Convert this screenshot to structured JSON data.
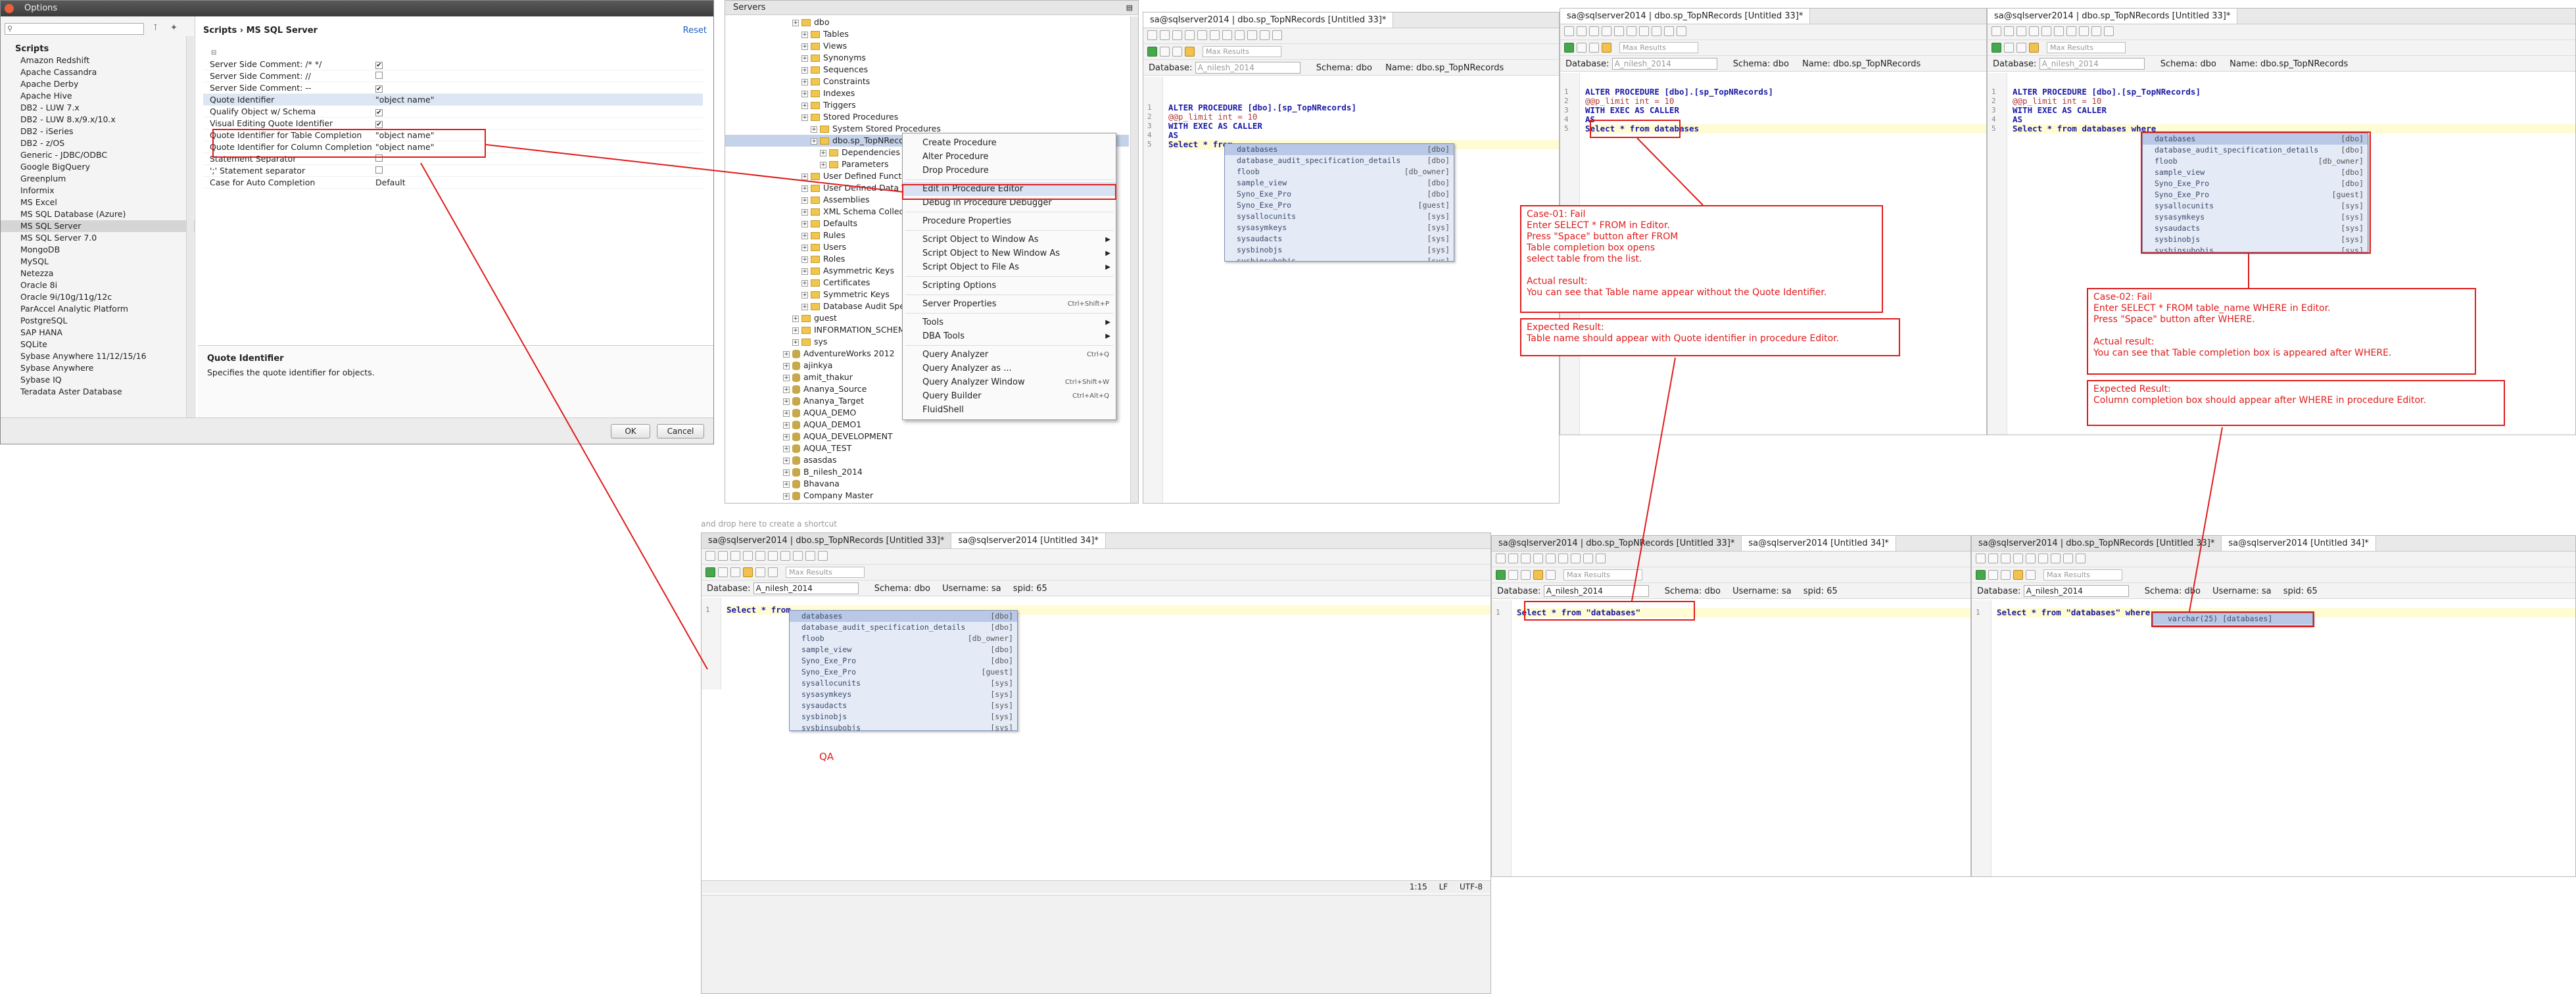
{
  "options": {
    "title": "Options",
    "heading": "Scripts",
    "panel_title": "Scripts › MS SQL Server",
    "reset": "Reset",
    "drivers": [
      "Amazon Redshift",
      "Apache Cassandra",
      "Apache Derby",
      "Apache Hive",
      "DB2 - LUW 7.x",
      "DB2 - LUW 8.x/9.x/10.x",
      "DB2 - iSeries",
      "DB2 - z/OS",
      "Generic - JDBC/ODBC",
      "Google BigQuery",
      "Greenplum",
      "Informix",
      "MS Excel",
      "MS SQL Database (Azure)",
      "MS SQL Server",
      "MS SQL Server 7.0",
      "MongoDB",
      "MySQL",
      "Netezza",
      "Oracle 8i",
      "Oracle 9i/10g/11g/12c",
      "ParAccel Analytic Platform",
      "PostgreSQL",
      "SAP HANA",
      "SQLite",
      "Sybase Anywhere 11/12/15/16",
      "Sybase Anywhere",
      "Sybase IQ",
      "Teradata Aster Database"
    ],
    "settings": [
      {
        "name": "Server Side Comment: /* */",
        "value": "✔"
      },
      {
        "name": "Server Side Comment: //",
        "value": ""
      },
      {
        "name": "Server Side Comment: --",
        "value": "✔"
      },
      {
        "name": "Quote Identifier",
        "value": "\"object name\""
      },
      {
        "name": "Qualify Object w/ Schema",
        "value": "✔"
      },
      {
        "name": "Visual Editing Quote Identifier",
        "value": "✔"
      },
      {
        "name": "Quote Identifier for Table Completion",
        "value": "\"object name\""
      },
      {
        "name": "Quote Identifier for Column Completion",
        "value": "\"object name\""
      },
      {
        "name": "Statement Separator",
        "value": ""
      },
      {
        "name": "';' Statement separator",
        "value": ""
      },
      {
        "name": "Case for Auto Completion",
        "value": "Default"
      }
    ],
    "desc_title": "Quote Identifier",
    "desc_text": "Specifies the quote identifier for objects.",
    "ok": "OK",
    "cancel": "Cancel"
  },
  "servers": {
    "title": "Servers",
    "nodes": [
      "dbo",
      "Tables",
      "Views",
      "Synonyms",
      "Sequences",
      "Constraints",
      "Indexes",
      "Triggers",
      "Stored Procedures",
      "System Stored Procedures",
      "dbo.sp_TopNRecords",
      "Dependencies",
      "Parameters",
      "User Defined Functions",
      "User Defined Data Types",
      "Assemblies",
      "XML Schema Collections",
      "Defaults",
      "Rules",
      "Users",
      "Roles",
      "Asymmetric Keys",
      "Certificates",
      "Symmetric Keys",
      "Database Audit Specifications",
      "guest",
      "INFORMATION_SCHEMA",
      "sys",
      "AdventureWorks 2012",
      "ajinkya",
      "amit_thakur",
      "Ananya_Source",
      "Ananya_Target",
      "AQUA_DEMO",
      "AQUA_DEMO1",
      "AQUA_DEVELOPMENT",
      "AQUA_TEST",
      "asasdas",
      "B_nilesh_2014",
      "Bhavana",
      "Company Master"
    ],
    "drop_hint": "and drop here to create a shortcut"
  },
  "context_menu": {
    "items": [
      {
        "label": "Create Procedure",
        "shortcut": "",
        "arrow": ""
      },
      {
        "label": "Alter Procedure",
        "shortcut": "",
        "arrow": ""
      },
      {
        "label": "Drop Procedure",
        "shortcut": "",
        "arrow": ""
      },
      {
        "label": "---"
      },
      {
        "label": "Edit in Procedure Editor",
        "shortcut": "",
        "arrow": ""
      },
      {
        "label": "Debug in Procedure Debugger",
        "shortcut": "",
        "arrow": ""
      },
      {
        "label": "---"
      },
      {
        "label": "Procedure Properties",
        "shortcut": "",
        "arrow": ""
      },
      {
        "label": "---"
      },
      {
        "label": "Script Object to Window As",
        "shortcut": "",
        "arrow": "▶"
      },
      {
        "label": "Script Object to New Window As",
        "shortcut": "",
        "arrow": "▶"
      },
      {
        "label": "Script Object to File As",
        "shortcut": "",
        "arrow": "▶"
      },
      {
        "label": "---"
      },
      {
        "label": "Scripting Options",
        "shortcut": "",
        "arrow": ""
      },
      {
        "label": "---"
      },
      {
        "label": "Server Properties",
        "shortcut": "Ctrl+Shift+P",
        "arrow": ""
      },
      {
        "label": "---"
      },
      {
        "label": "Tools",
        "shortcut": "",
        "arrow": "▶"
      },
      {
        "label": "DBA Tools",
        "shortcut": "",
        "arrow": "▶"
      },
      {
        "label": "---"
      },
      {
        "label": "Query Analyzer",
        "shortcut": "Ctrl+Q",
        "arrow": ""
      },
      {
        "label": "Query Analyzer as ...",
        "shortcut": "",
        "arrow": ""
      },
      {
        "label": "Query Analyzer Window",
        "shortcut": "Ctrl+Shift+W",
        "arrow": ""
      },
      {
        "label": "Query Builder",
        "shortcut": "Ctrl+Alt+Q",
        "arrow": ""
      },
      {
        "label": "FluidShell",
        "shortcut": "",
        "arrow": ""
      }
    ]
  },
  "editor_common": {
    "max_results": "Max Results",
    "database_label": "Database:",
    "schema_label": "Schema:",
    "schema": "dbo",
    "name_label": "Name:",
    "proc_name": "dbo.sp_TopNRecords",
    "db_greyed": "A_nilesh_2014",
    "db": "A_nilesh_2014",
    "username_label": "Username:",
    "username": "sa",
    "spid_label": "spid:",
    "spid": "65",
    "tab33": "sa@sqlserver2014 | dbo.sp_TopNRecords [Untitled 33]*",
    "tab34": "sa@sqlserver2014 [Untitled 34]*",
    "status_pos": "1:15",
    "status_lf": "LF",
    "status_enc": "UTF-8"
  },
  "proc_lines": {
    "l1": "ALTER PROCEDURE [dbo].[sp_TopNRecords]",
    "l2": "@@p_limit int = 10",
    "l3": "WITH EXEC AS CALLER",
    "l4": "AS",
    "l5a": "Select * from",
    "l5b": "Select * from databases",
    "l5c": "Select * from databases where"
  },
  "qa_lines": {
    "a": "Select * from",
    "b": "Select * from \"databases\"",
    "c": "Select * from \"databases\" where"
  },
  "autocomplete": [
    {
      "name": "databases",
      "schema": "[dbo]"
    },
    {
      "name": "database_audit_specification_details",
      "schema": "[dbo]"
    },
    {
      "name": "floob",
      "schema": "[db_owner]"
    },
    {
      "name": "sample_view",
      "schema": "[dbo]"
    },
    {
      "name": "Syno_Exe_Pro",
      "schema": "[dbo]"
    },
    {
      "name": "Syno_Exe_Pro",
      "schema": "[guest]"
    },
    {
      "name": "sysallocunits",
      "schema": "[sys]"
    },
    {
      "name": "sysasymkeys",
      "schema": "[sys]"
    },
    {
      "name": "sysaudacts",
      "schema": "[sys]"
    },
    {
      "name": "sysbinobjs",
      "schema": "[sys]"
    },
    {
      "name": "sysbinsubobjs",
      "schema": "[sys]"
    }
  ],
  "column_completion": "varchar(25)   [databases]",
  "notes": {
    "case1_title": "Case-01: Fail",
    "case1_steps": "Enter SELECT * FROM in Editor.\nPress \"Space\" button after FROM\nTable completion box opens\nselect table from the list.",
    "case1_actual_title": "Actual result:",
    "case1_actual": "You can see that Table name appear without the Quote Identifier.",
    "case1_expected_title": "Expected Result:",
    "case1_expected": "Table name should appear with Quote identifier in procedure Editor.",
    "case2_title": "Case-02: Fail",
    "case2_steps": "Enter SELECT * FROM table_name WHERE in Editor.\nPress \"Space\" button after WHERE.",
    "case2_actual_title": "Actual result:",
    "case2_actual": "You can see that Table completion box is appeared after WHERE.",
    "case2_expected_title": "Expected Result:",
    "case2_expected": "Column completion box should appear after WHERE in procedure Editor.",
    "qa_label": "QA"
  },
  "colors": {
    "annotation_red": "#e01b1b",
    "keyword_blue": "#1a1aa6",
    "autocomplete_bg": "#e4ebf7",
    "current_line": "#fffbd3"
  }
}
